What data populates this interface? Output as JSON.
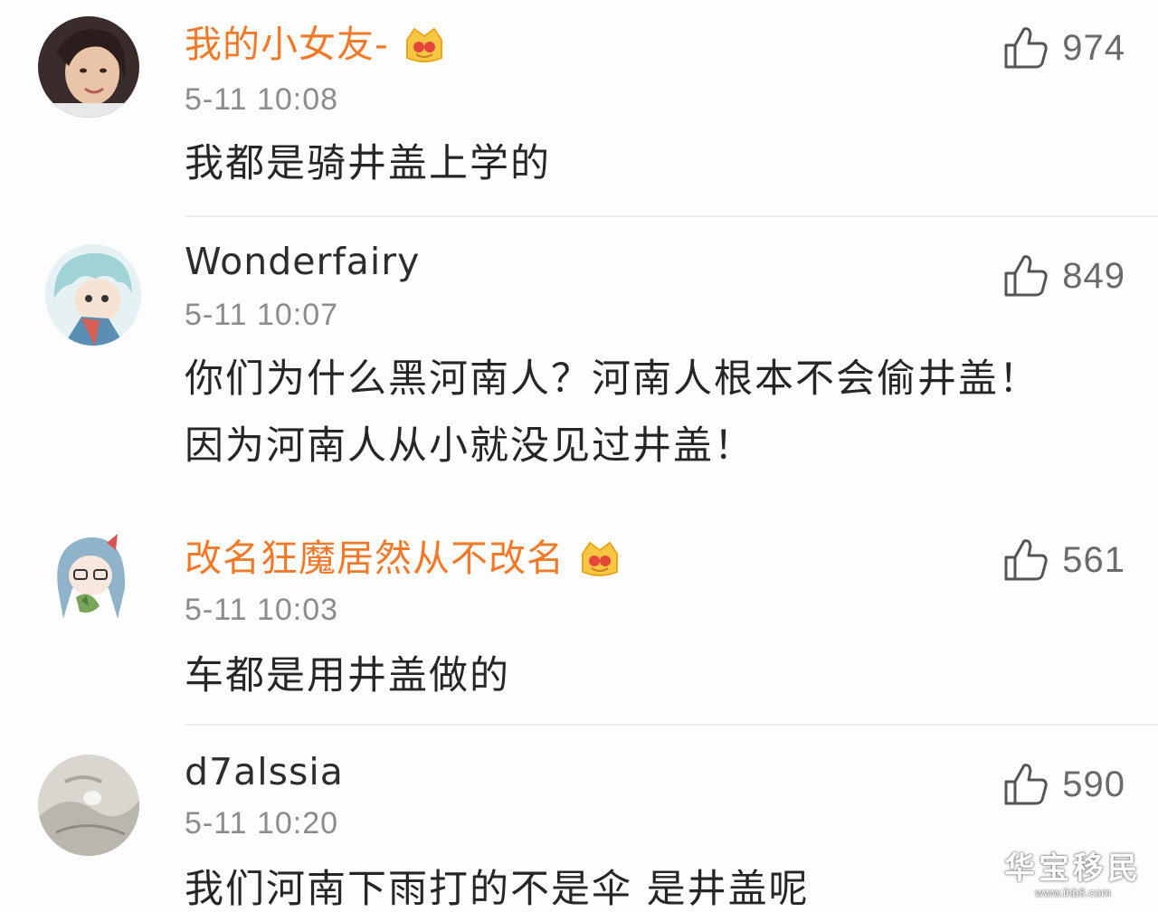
{
  "comments": [
    {
      "username": "我的小女友-",
      "vip": true,
      "time": "5-11 10:08",
      "text": "我都是骑井盖上学的",
      "likes": "974"
    },
    {
      "username": "Wonderfairy",
      "vip": false,
      "time": "5-11 10:07",
      "text": "你们为什么黑河南人？河南人根本不会偷井盖！因为河南人从小就没见过井盖！",
      "likes": "849"
    },
    {
      "username": "改名狂魔居然从不改名",
      "vip": true,
      "time": "5-11 10:03",
      "text": "车都是用井盖做的",
      "likes": "561"
    },
    {
      "username": "d7alssia",
      "vip": false,
      "time": "5-11 10:20",
      "text": "我们河南下雨打的不是伞 是井盖呢",
      "likes": "590"
    }
  ],
  "watermark": {
    "main": "华宝移民",
    "sub": "www.ihb8.com"
  },
  "colors": {
    "vip_name": "#f07a2a",
    "name": "#2d2d2d",
    "time": "#8c8c8c",
    "text": "#262626",
    "like": "#6a6a6a"
  },
  "icons": [
    "thumbs-up-icon",
    "vip-crown-icon",
    "avatar"
  ]
}
